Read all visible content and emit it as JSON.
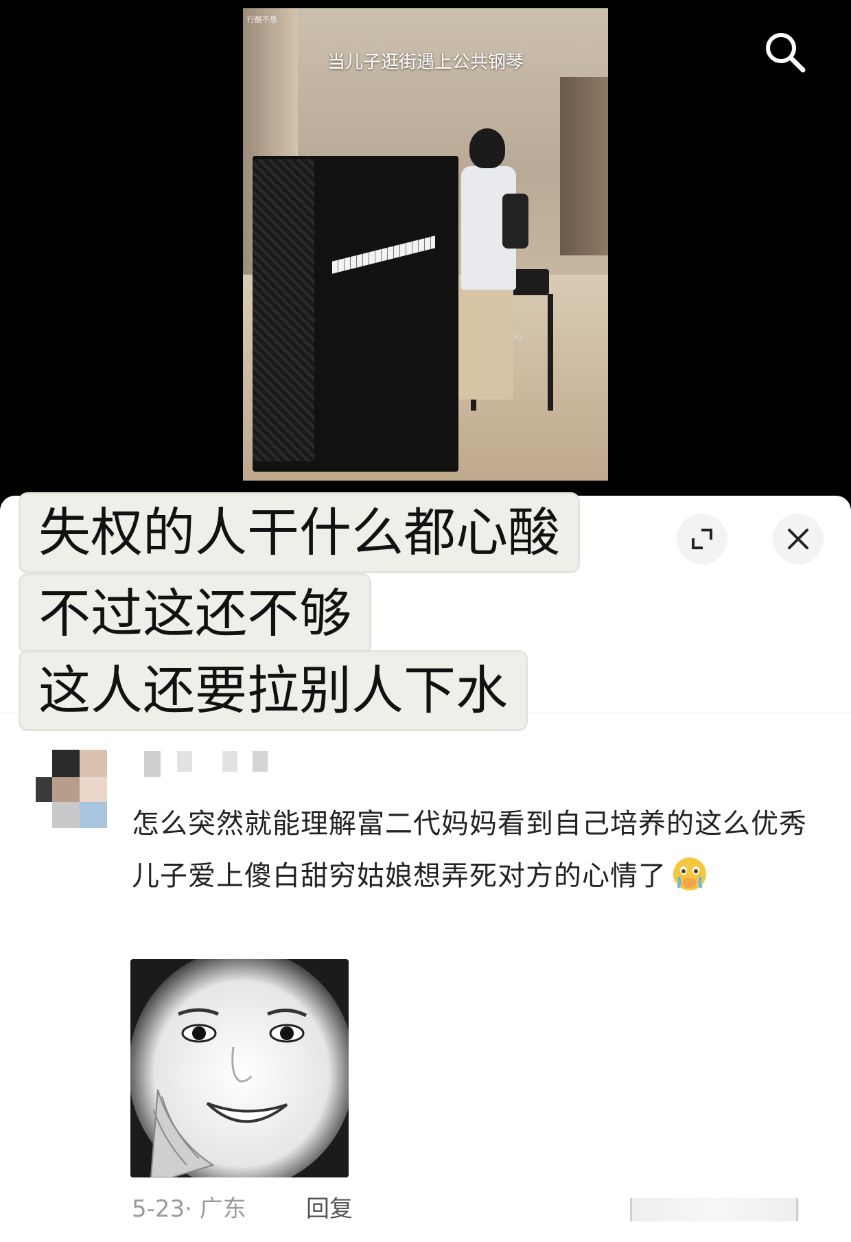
{
  "video": {
    "caption": "当儿子逛街遇上公共钢琴",
    "corner_tag": "行醒不息",
    "bench_brand": "DANDIGU",
    "search_icon": "search-icon"
  },
  "sheet": {
    "headline": [
      "失权的人干什么都心酸",
      "不过这还不够",
      "这人还要拉别人下水"
    ],
    "expand_icon": "expand-icon",
    "close_icon": "close-icon"
  },
  "comment": {
    "text": "怎么突然就能理解富二代妈妈看到自己培养的这么优秀儿子爱上傻白甜穷姑娘想弄死对方的心情了",
    "emoji_icon": "crying-face-emoji-icon",
    "meta": "5-23· 广东",
    "reply_label": "回复"
  },
  "colors": {
    "background_top": "#000000",
    "sheet": "#ffffff",
    "headline_bg": "#efefe9",
    "meta_gray": "#9a9a9a"
  }
}
